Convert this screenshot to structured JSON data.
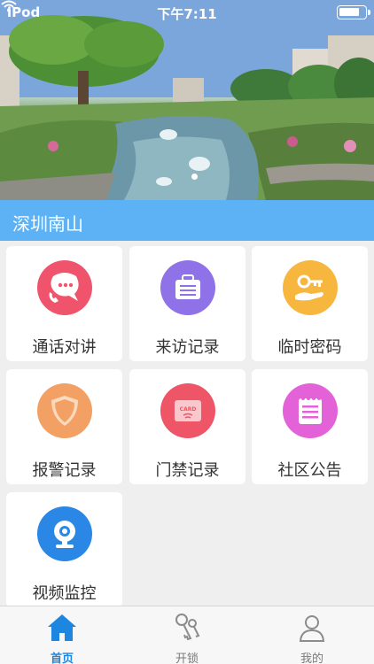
{
  "status_bar": {
    "carrier": "iPod",
    "time": "下午7:11"
  },
  "location": {
    "name": "深圳南山"
  },
  "grid": [
    {
      "label": "通话对讲",
      "icon": "phone-chat-icon",
      "color": "#f0546c"
    },
    {
      "label": "来访记录",
      "icon": "briefcase-icon",
      "color": "#8f72e8"
    },
    {
      "label": "临时密码",
      "icon": "key-hand-icon",
      "color": "#f7b73e"
    },
    {
      "label": "报警记录",
      "icon": "shield-icon",
      "color": "#f2a063"
    },
    {
      "label": "门禁记录",
      "icon": "card-icon",
      "color": "#ee5566"
    },
    {
      "label": "社区公告",
      "icon": "notepad-icon",
      "color": "#e462d8"
    },
    {
      "label": "视频监控",
      "icon": "webcam-icon",
      "color": "#2a87e6"
    }
  ],
  "tabs": [
    {
      "label": "首页",
      "icon": "home-icon",
      "active": true
    },
    {
      "label": "开锁",
      "icon": "keys-icon",
      "active": false
    },
    {
      "label": "我的",
      "icon": "person-icon",
      "active": false
    }
  ],
  "colors": {
    "accent": "#1d86e0",
    "location_bar": "#5db1f5"
  }
}
